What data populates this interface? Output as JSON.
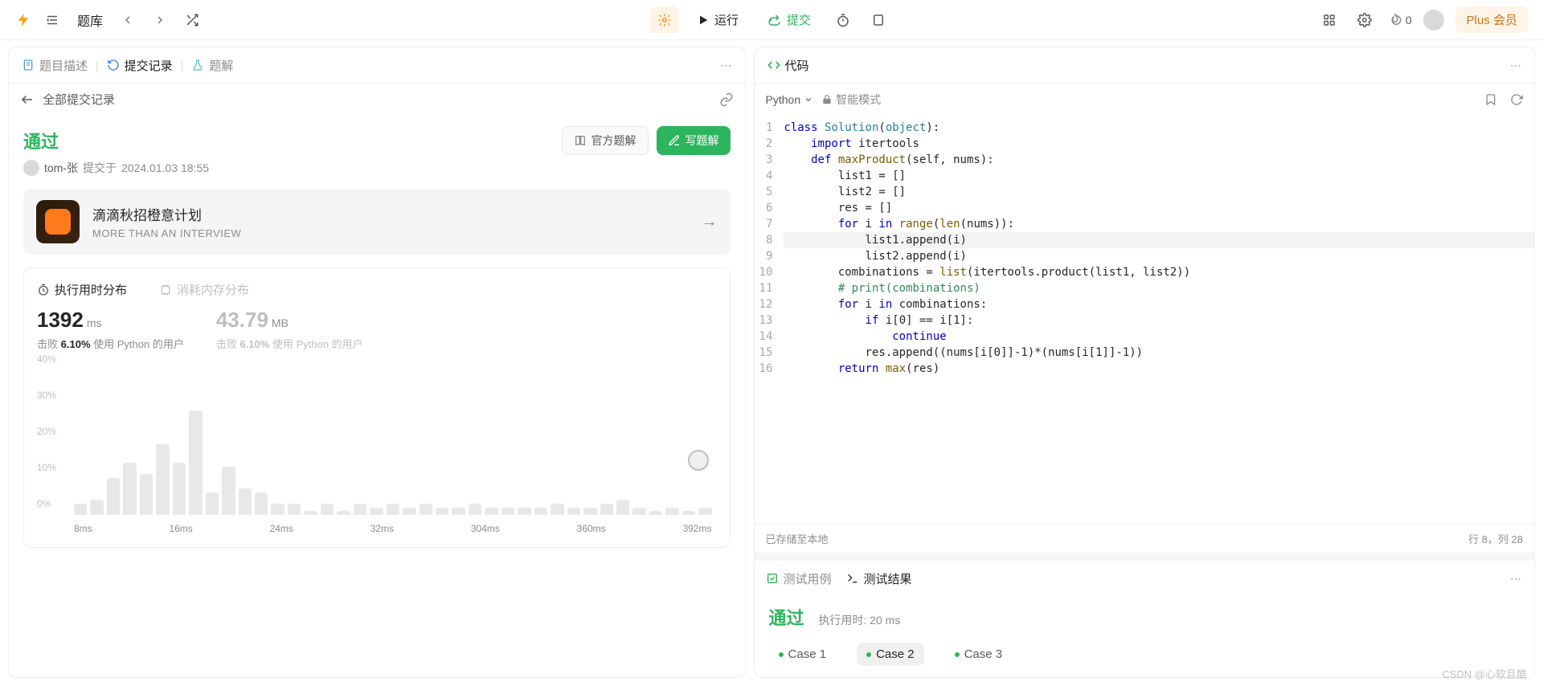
{
  "topbar": {
    "problems_label": "题库",
    "run_label": "运行",
    "submit_label": "提交",
    "streak_count": "0",
    "plus_label": "Plus 会员"
  },
  "left": {
    "tabs": {
      "desc": "题目描述",
      "history": "提交记录",
      "solution": "题解"
    },
    "subhead": {
      "title": "全部提交记录"
    },
    "status": "通过",
    "official_btn": "官方题解",
    "write_btn": "写题解",
    "submitter": {
      "name": "tom-张",
      "prefix": "提交于",
      "time": "2024.01.03 18:55"
    },
    "promo": {
      "title": "滴滴秋招橙意计划",
      "subtitle": "MORE THAN AN INTERVIEW"
    },
    "stats": {
      "tab_time": "执行用时分布",
      "tab_mem": "消耗内存分布",
      "time_value": "1392",
      "time_unit": "ms",
      "time_sub_prefix": "击败",
      "time_sub_pct": "6.10%",
      "time_sub_suffix": "使用 Python 的用户",
      "mem_value": "43.79",
      "mem_unit": "MB",
      "mem_sub_prefix": "击败",
      "mem_sub_pct": "6.10%",
      "mem_sub_suffix": "使用 Python 的用户"
    }
  },
  "chart_data": {
    "type": "bar",
    "title": "执行用时分布",
    "xlabel": "",
    "ylabel": "%",
    "ylim": [
      0,
      40
    ],
    "y_ticks": [
      "0%",
      "10%",
      "20%",
      "30%",
      "40%"
    ],
    "x_ticks": [
      "8ms",
      "16ms",
      "24ms",
      "32ms",
      "304ms",
      "360ms",
      "392ms"
    ],
    "values": [
      3,
      4,
      10,
      14,
      11,
      19,
      14,
      28,
      6,
      13,
      7,
      6,
      3,
      3,
      1,
      3,
      1,
      3,
      2,
      3,
      2,
      3,
      2,
      2,
      3,
      2,
      2,
      2,
      2,
      3,
      2,
      2,
      3,
      4,
      2,
      1,
      2,
      1,
      2
    ]
  },
  "code": {
    "title": "代码",
    "language": "Python",
    "smart_mode": "智能模式",
    "saved_text": "已存储至本地",
    "cursor_text": "行 8，列 28",
    "lines": [
      {
        "n": 1,
        "segs": [
          [
            "kw",
            "class "
          ],
          [
            "cls",
            "Solution"
          ],
          [
            "",
            "("
          ],
          [
            "cls",
            "object"
          ],
          [
            "",
            "):"
          ]
        ]
      },
      {
        "n": 2,
        "segs": [
          [
            "",
            "    "
          ],
          [
            "kw",
            "import "
          ],
          [
            "",
            "itertools"
          ]
        ]
      },
      {
        "n": 3,
        "segs": [
          [
            "",
            "    "
          ],
          [
            "kw",
            "def "
          ],
          [
            "fn",
            "maxProduct"
          ],
          [
            "",
            "(self, nums):"
          ]
        ]
      },
      {
        "n": 4,
        "segs": [
          [
            "",
            "        list1 = []"
          ]
        ]
      },
      {
        "n": 5,
        "segs": [
          [
            "",
            "        list2 = []"
          ]
        ]
      },
      {
        "n": 6,
        "segs": [
          [
            "",
            "        res = []"
          ]
        ]
      },
      {
        "n": 7,
        "segs": [
          [
            "",
            "        "
          ],
          [
            "kw",
            "for "
          ],
          [
            "",
            "i "
          ],
          [
            "kw",
            "in "
          ],
          [
            "fn",
            "range"
          ],
          [
            "",
            "("
          ],
          [
            "fn",
            "len"
          ],
          [
            "",
            "(nums)):"
          ]
        ]
      },
      {
        "n": 8,
        "cur": true,
        "segs": [
          [
            "",
            "            list1.append(i)"
          ]
        ]
      },
      {
        "n": 9,
        "segs": [
          [
            "",
            "            list2.append(i)"
          ]
        ]
      },
      {
        "n": 10,
        "segs": [
          [
            "",
            "        combinations = "
          ],
          [
            "fn",
            "list"
          ],
          [
            "",
            "(itertools.product(list1, list2))"
          ]
        ]
      },
      {
        "n": 11,
        "segs": [
          [
            "",
            "        "
          ],
          [
            "com",
            "# print(combinations)"
          ]
        ]
      },
      {
        "n": 12,
        "segs": [
          [
            "",
            "        "
          ],
          [
            "kw",
            "for "
          ],
          [
            "",
            "i "
          ],
          [
            "kw",
            "in "
          ],
          [
            "",
            "combinations:"
          ]
        ]
      },
      {
        "n": 13,
        "segs": [
          [
            "",
            "            "
          ],
          [
            "kw",
            "if "
          ],
          [
            "",
            "i[0] == i[1]:"
          ]
        ]
      },
      {
        "n": 14,
        "segs": [
          [
            "",
            "                "
          ],
          [
            "kw",
            "continue"
          ]
        ]
      },
      {
        "n": 15,
        "segs": [
          [
            "",
            "            res.append((nums[i[0]]-1)*(nums[i[1]]-1))"
          ]
        ]
      },
      {
        "n": 16,
        "segs": [
          [
            "",
            "        "
          ],
          [
            "kw",
            "return "
          ],
          [
            "fn",
            "max"
          ],
          [
            "",
            "(res)"
          ]
        ]
      }
    ]
  },
  "results": {
    "tab_cases": "测试用例",
    "tab_results": "测试结果",
    "status": "通过",
    "runtime_label": "执行用时: 20 ms",
    "cases": [
      "Case 1",
      "Case 2",
      "Case 3"
    ],
    "active_case": 1
  },
  "watermark": "CSDN @心软且酷"
}
